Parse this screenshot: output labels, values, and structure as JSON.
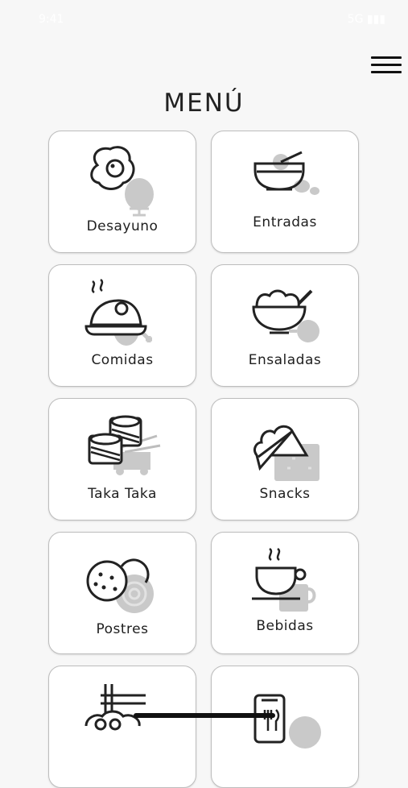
{
  "status_bar": {
    "time": "9:41",
    "right": "5G ▮▮▮"
  },
  "header": {
    "title": "MENÚ",
    "menu_icon": "hamburger-icon"
  },
  "categories": [
    {
      "label": "Desayuno",
      "icon": "fried-egg-icon"
    },
    {
      "label": "Entradas",
      "icon": "soup-bowl-icon"
    },
    {
      "label": "Comidas",
      "icon": "roast-chicken-icon"
    },
    {
      "label": "Ensaladas",
      "icon": "salad-bowl-icon"
    },
    {
      "label": "Taka Taka",
      "icon": "sushi-icon"
    },
    {
      "label": "Snacks",
      "icon": "sandwich-icon"
    },
    {
      "label": "Postres",
      "icon": "cookies-icon"
    },
    {
      "label": "Bebidas",
      "icon": "coffee-cup-icon"
    },
    {
      "label": "",
      "icon": "noodles-icon"
    },
    {
      "label": "",
      "icon": "phone-order-icon"
    }
  ]
}
